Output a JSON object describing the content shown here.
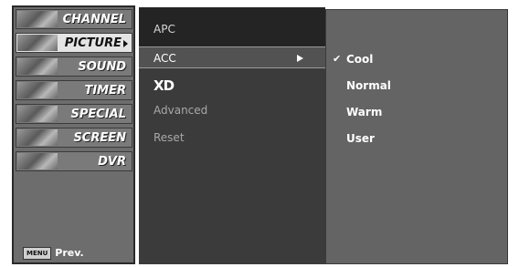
{
  "left_menu": {
    "items": [
      {
        "label": "CHANNEL"
      },
      {
        "label": "PICTURE"
      },
      {
        "label": "SOUND"
      },
      {
        "label": "TIMER"
      },
      {
        "label": "SPECIAL"
      },
      {
        "label": "SCREEN"
      },
      {
        "label": "DVR"
      }
    ],
    "selected": "PICTURE",
    "menu_key": "MENU",
    "prev_label": "Prev."
  },
  "picture_menu": {
    "items": [
      {
        "label": "APC"
      },
      {
        "label": "ACC"
      },
      {
        "label": "XD"
      },
      {
        "label": "Advanced"
      },
      {
        "label": "Reset"
      }
    ],
    "selected": "ACC"
  },
  "acc_options": {
    "items": [
      {
        "label": "Cool"
      },
      {
        "label": "Normal"
      },
      {
        "label": "Warm"
      },
      {
        "label": "User"
      }
    ],
    "checked": "Cool",
    "check_mark": "✔"
  }
}
